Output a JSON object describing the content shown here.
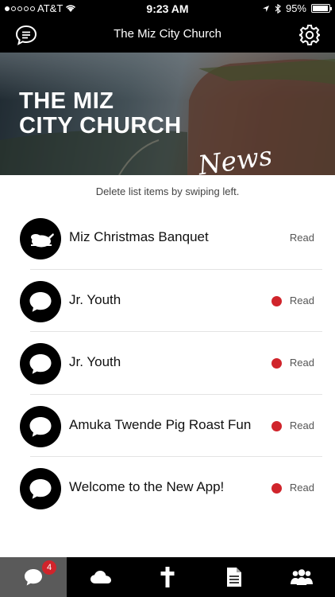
{
  "status_bar": {
    "carrier": "AT&T",
    "time": "9:23 AM",
    "battery_percent": "95%",
    "battery_level": 0.95,
    "signal_bars_filled": 1
  },
  "nav": {
    "title": "The Miz City Church",
    "left_icon": "chat-bubble-icon",
    "right_icon": "gear-icon"
  },
  "hero": {
    "brand_line1": "THE MIZ",
    "brand_line2": "CITY CHURCH",
    "script_text": "News feed"
  },
  "hint": "Delete list items by swiping left.",
  "items": [
    {
      "title": "Miz Christmas Banquet",
      "status": "Read",
      "unread": false,
      "icon": "turkey-icon"
    },
    {
      "title": "Jr. Youth",
      "status": "Read",
      "unread": true,
      "icon": "chat-bubble-icon"
    },
    {
      "title": "Jr. Youth",
      "status": "Read",
      "unread": true,
      "icon": "chat-bubble-icon"
    },
    {
      "title": "Amuka Twende Pig Roast Fun",
      "status": "Read",
      "unread": true,
      "icon": "chat-bubble-icon"
    },
    {
      "title": "Welcome to the New App!",
      "status": "Read",
      "unread": true,
      "icon": "chat-bubble-icon"
    }
  ],
  "tabs": [
    {
      "icon": "chat-bubble-icon",
      "badge": "4",
      "active": true
    },
    {
      "icon": "cloud-icon"
    },
    {
      "icon": "cross-icon"
    },
    {
      "icon": "document-icon"
    },
    {
      "icon": "people-icon"
    }
  ],
  "colors": {
    "bar_background": "#000000",
    "unread_dot": "#d0242b",
    "badge": "#d0242b",
    "active_tab": "#5a5a5a"
  }
}
